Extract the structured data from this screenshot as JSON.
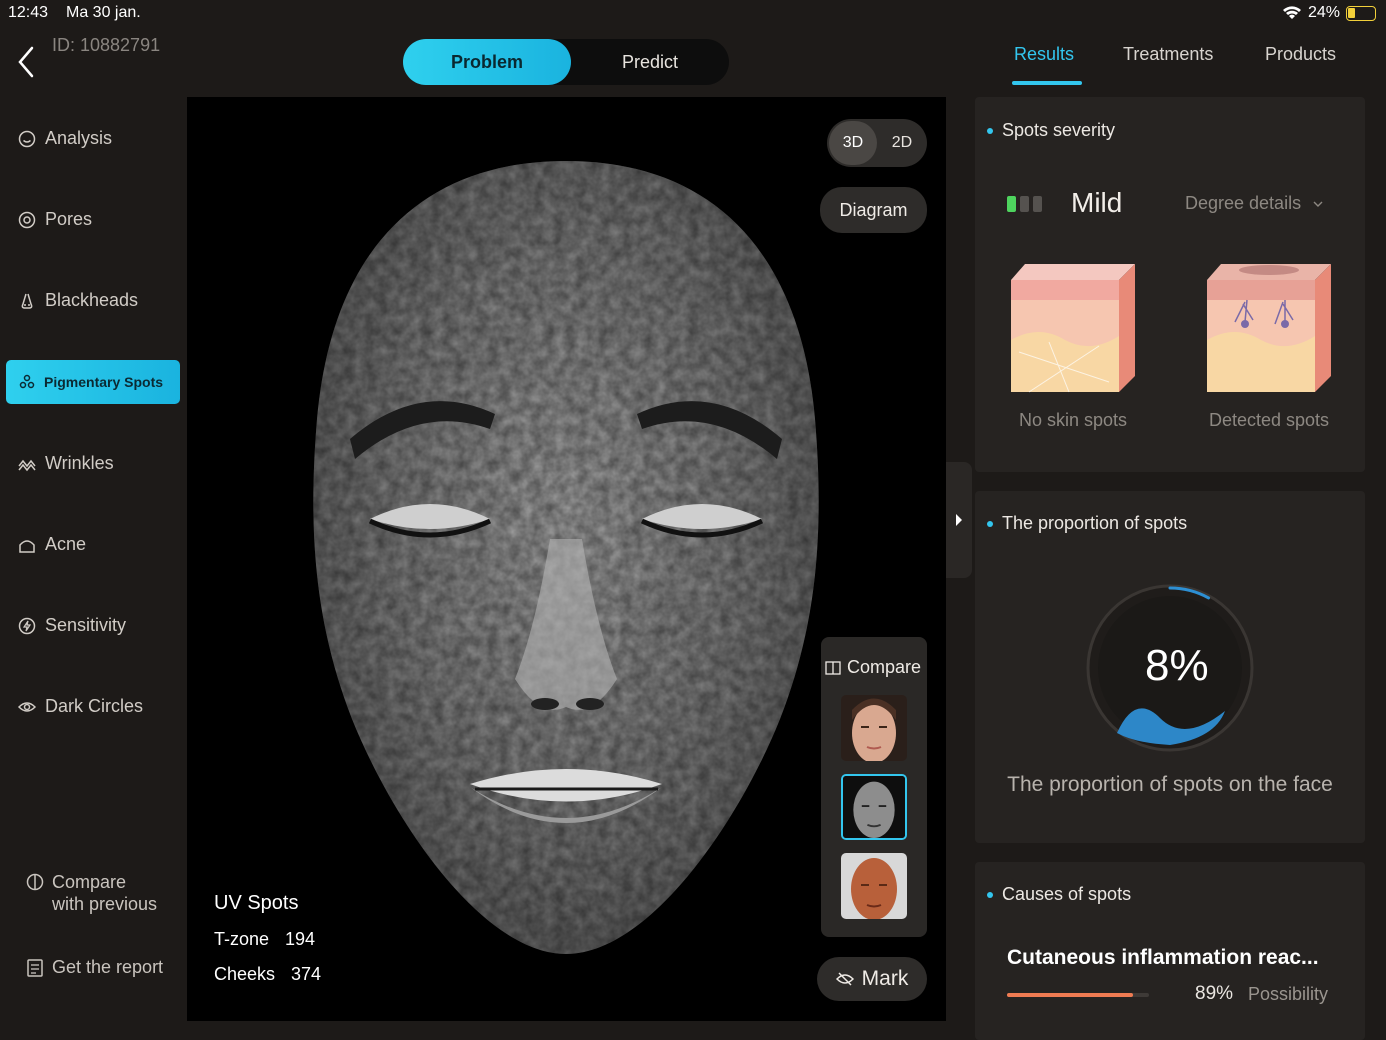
{
  "status": {
    "time": "12:43",
    "date": "Ma 30 jan.",
    "battery": "24%"
  },
  "header": {
    "id_label": "ID: 10882791"
  },
  "segment": {
    "problem": "Problem",
    "predict": "Predict"
  },
  "right_tabs": [
    "Results",
    "Treatments",
    "Products"
  ],
  "sidebar": {
    "items": [
      {
        "label": "Analysis",
        "icon": "smile-icon"
      },
      {
        "label": "Pores",
        "icon": "target-icon"
      },
      {
        "label": "Blackheads",
        "icon": "nose-icon"
      },
      {
        "label": "Pigmentary Spots",
        "icon": "dots-icon",
        "active": true
      },
      {
        "label": "Wrinkles",
        "icon": "wave-icon"
      },
      {
        "label": "Acne",
        "icon": "bump-icon"
      },
      {
        "label": "Sensitivity",
        "icon": "bolt-circle-icon"
      },
      {
        "label": "Dark Circles",
        "icon": "eye-icon"
      }
    ],
    "compare_line1": "Compare",
    "compare_line2": "with previous",
    "report": "Get the report"
  },
  "viewer": {
    "mode_3d": "3D",
    "mode_2d": "2D",
    "diagram": "Diagram",
    "compare": "Compare",
    "mark": "Mark",
    "uv_title": "UV Spots",
    "tzone_label": "T-zone",
    "tzone_value": "194",
    "cheeks_label": "Cheeks",
    "cheeks_value": "374"
  },
  "severity": {
    "title": "Spots severity",
    "level": "Mild",
    "level_index": 1,
    "level_total": 3,
    "details": "Degree details",
    "no_spots": "No skin spots",
    "detected": "Detected spots"
  },
  "proportion": {
    "title": "The proportion of spots",
    "value": "8%",
    "percent": 8,
    "label": "The proportion of spots on the face"
  },
  "causes": {
    "title": "Causes of spots",
    "cause": "Cutaneous inflammation reac...",
    "percent_text": "89%",
    "percent": 89,
    "possibility": "Possibility"
  },
  "colors": {
    "accent": "#33c6ee",
    "severity_on": "#4ed45e",
    "cause_bar": "#ef7b52"
  }
}
